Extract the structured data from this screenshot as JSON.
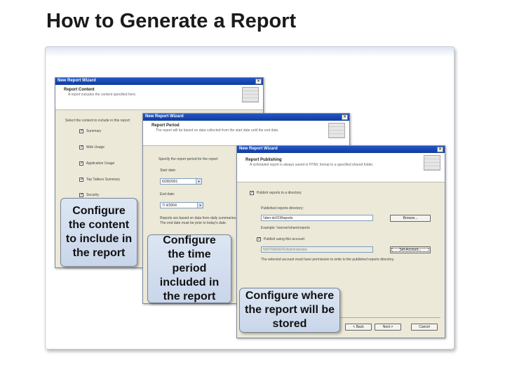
{
  "slide": {
    "title": "How to Generate a Report"
  },
  "wizard1": {
    "window_title": "New Report Wizard",
    "close": "×",
    "header_title": "Report Content",
    "header_desc": "A report includes the content specified here.",
    "prompt": "Select the content to include in this report:",
    "options": [
      "Summary",
      "Web Usage",
      "Application Usage",
      "Top Talkers Summary",
      "Security"
    ]
  },
  "wizard2": {
    "window_title": "New Report Wizard",
    "close": "×",
    "header_title": "Report Period",
    "header_desc": "The report will be based on data collected from the start date until the end date.",
    "prompt": "Specify the report period for the report",
    "start_label": "Start date:",
    "start_value": "6/28/2001",
    "end_label": "End date:",
    "end_value": "7/ 4/2004",
    "note": "Reports are based on data from daily summaries. The end date must be prior to today's date."
  },
  "wizard3": {
    "window_title": "New Report Wizard",
    "close": "×",
    "header_title": "Report Publishing",
    "header_desc": "A scheduled report is always saved in HTML format to a specified shared folder.",
    "publish_label": "Publish reports to a directory",
    "dir_label": "Published reports directory:",
    "dir_value": "\\\\den-dc01\\Reports",
    "browse": "Browse...",
    "example": "Example: \\\\server\\share\\reports",
    "account_label": "Publish using this account:",
    "account_value": "NWTRADERS\\Administrator",
    "set_account": "Set Account...",
    "note": "The selected account must have permission to write to the published reports directory.",
    "back": "< Back",
    "next": "Next >",
    "cancel": "Cancel"
  },
  "callouts": {
    "content": "Configure the content to include in the report",
    "period": "Configure the time period included in the report",
    "publish": "Configure where the report will be stored"
  }
}
